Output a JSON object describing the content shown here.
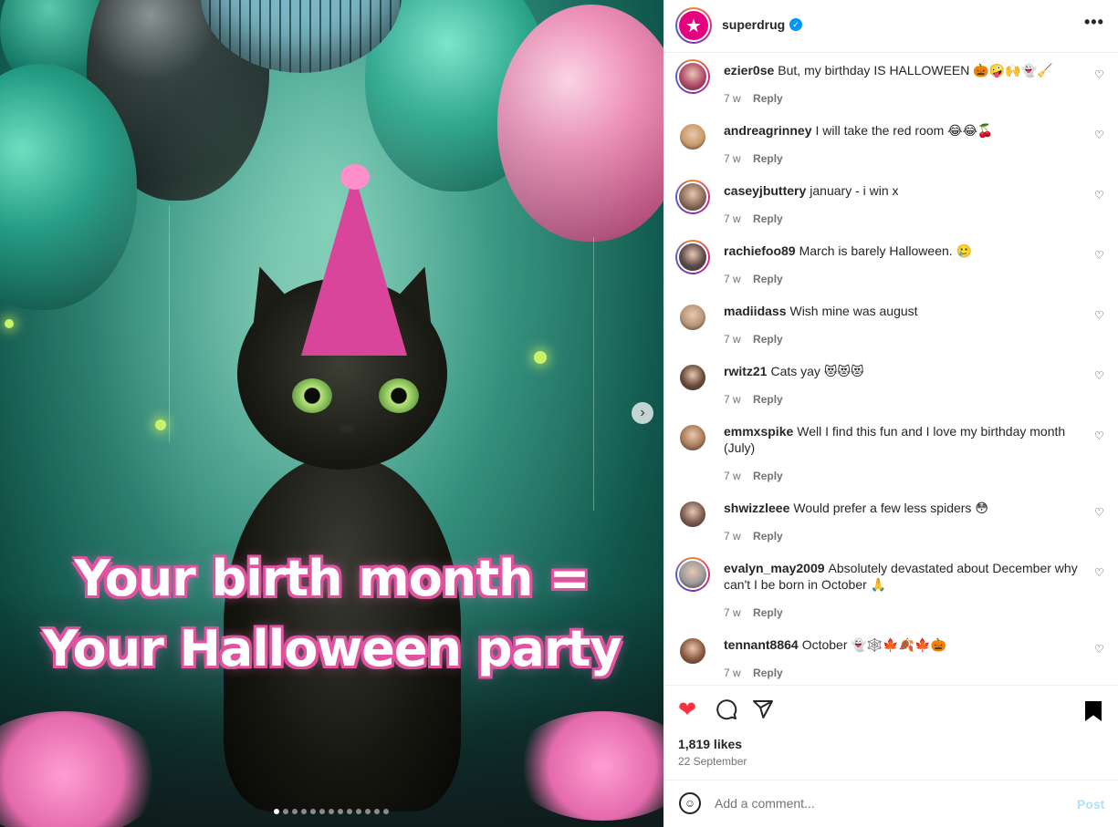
{
  "post": {
    "image_caption_line1": "Your birth month =",
    "image_caption_line2": "Your Halloween party",
    "carousel_count": 13,
    "carousel_active": 0
  },
  "header": {
    "username": "superdrug",
    "verified": true,
    "more_icon": "more-horizontal-icon"
  },
  "comments": [
    {
      "user": "ezier0se",
      "text": "But, my birthday IS HALLOWEEN 🎃🤪🙌👻🧹",
      "time": "7 w",
      "reply": "Reply",
      "avatar_color": "#b24a6a",
      "ring": true
    },
    {
      "user": "andreagrinney",
      "text": "I will take the red room 😂😂🍒",
      "time": "7 w",
      "reply": "Reply",
      "avatar_color": "#c99a6b",
      "ring": false
    },
    {
      "user": "caseyjbuttery",
      "text": "january - i win x",
      "time": "7 w",
      "reply": "Reply",
      "avatar_color": "#8a6a5a",
      "ring": true
    },
    {
      "user": "rachiefoo89",
      "text": "March is barely Halloween. 🥲",
      "time": "7 w",
      "reply": "Reply",
      "avatar_color": "#5a4a4a",
      "ring": true
    },
    {
      "user": "madiidass",
      "text": "Wish mine was august",
      "time": "7 w",
      "reply": "Reply",
      "avatar_color": "#b89478",
      "ring": false
    },
    {
      "user": "rwitz21",
      "text": "Cats yay 😻😻😻",
      "time": "7 w",
      "reply": "Reply",
      "avatar_color": "#6a4a3a",
      "ring": false
    },
    {
      "user": "emmxspike",
      "text": "Well I find this fun and I love my birthday month (July)",
      "time": "7 w",
      "reply": "Reply",
      "avatar_color": "#a87a5a",
      "ring": false
    },
    {
      "user": "shwizzleee",
      "text": "Would prefer a few less spiders 😳",
      "time": "7 w",
      "reply": "Reply",
      "avatar_color": "#7a5a50",
      "ring": false
    },
    {
      "user": "evalyn_may2009",
      "text": "Absolutely devastated about December why can't I be born in October 🙏",
      "time": "7 w",
      "reply": "Reply",
      "avatar_color": "#9a9a9a",
      "ring": true
    },
    {
      "user": "tennant8864",
      "text": "October 👻🕸️🍁🍂🍁🎃",
      "time": "7 w",
      "reply": "Reply",
      "avatar_color": "#8a5a40",
      "ring": false
    }
  ],
  "actions": {
    "likes": "1,819 likes",
    "date": "22 September",
    "liked": true
  },
  "composer": {
    "placeholder": "Add a comment...",
    "post_label": "Post"
  },
  "colors": {
    "like_red": "#ff3040",
    "verified_blue": "#0095f6",
    "post_disabled": "#b2dffc",
    "brand_pink": "#e5007e"
  }
}
